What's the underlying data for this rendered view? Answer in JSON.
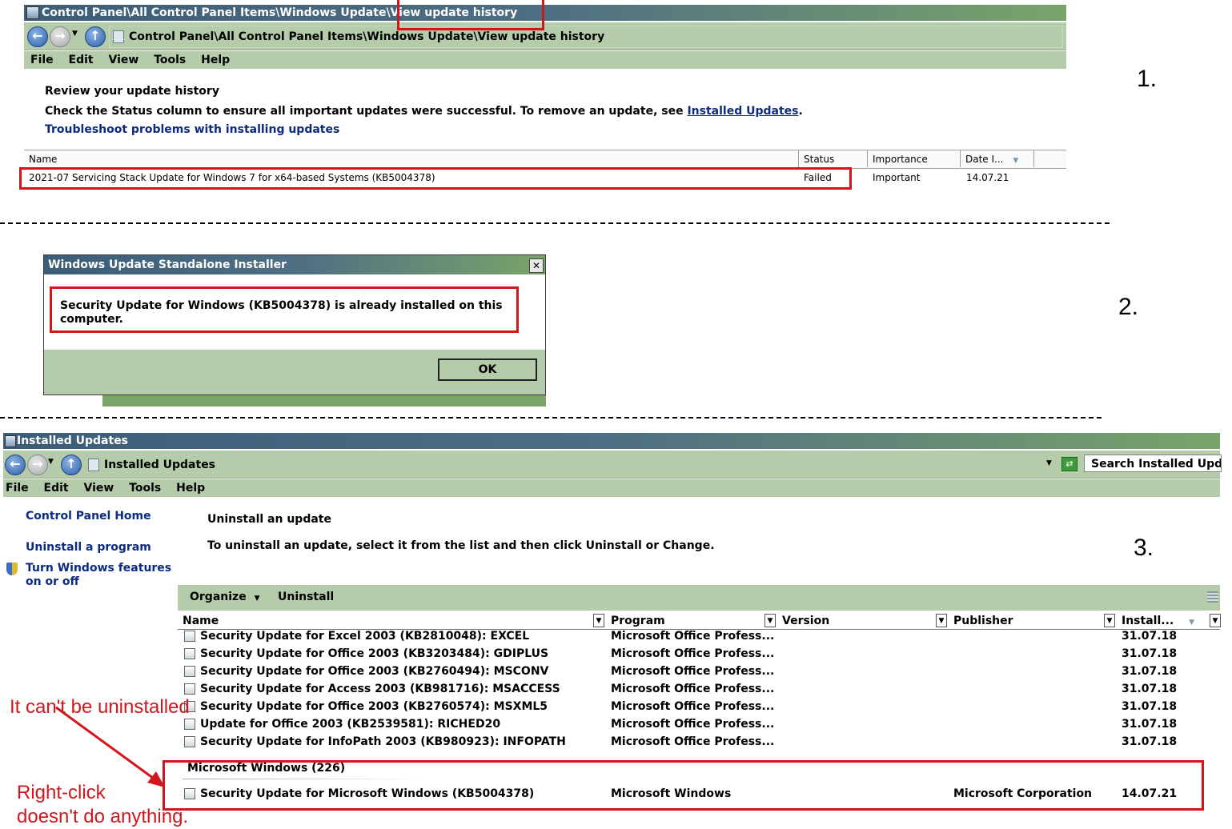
{
  "section1": {
    "title": "Control Panel\\All Control Panel Items\\Windows Update\\View update history",
    "address": "Control Panel\\All Control Panel Items\\Windows Update\\View update history",
    "menu": [
      "File",
      "Edit",
      "View",
      "Tools",
      "Help"
    ],
    "heading": "Review your update history",
    "description_prefix": "Check the Status column to ensure all important updates were successful. To remove an update, see ",
    "installed_updates_link": "Installed Updates",
    "description_suffix": ".",
    "troubleshoot_link": "Troubleshoot problems with installing updates",
    "columns": [
      "Name",
      "Status",
      "Importance",
      "Date I..."
    ],
    "row": {
      "name": "2021-07 Servicing Stack Update for Windows 7 for x64-based Systems (KB5004378)",
      "status": "Failed",
      "importance": "Important",
      "date": "14.07.21"
    },
    "number": "1."
  },
  "section2": {
    "title": "Windows Update Standalone Installer",
    "close_glyph": "✕",
    "message_line1": "Security Update for Windows (KB5004378) is already installed on this",
    "message_line2": "computer.",
    "ok_label": "OK",
    "number": "2."
  },
  "section3": {
    "title": "Installed Updates",
    "address": "Installed Updates",
    "search_placeholder": "Search Installed Upd",
    "menu": [
      "File",
      "Edit",
      "View",
      "Tools",
      "Help"
    ],
    "sidebar": {
      "home": "Control Panel Home",
      "uninstall_program": "Uninstall a program",
      "features_line1": "Turn Windows features",
      "features_line2": "on or off"
    },
    "heading": "Uninstall an update",
    "description": "To uninstall an update, select it from the list and then click Uninstall or Change.",
    "toolbar": {
      "organize": "Organize",
      "uninstall": "Uninstall"
    },
    "columns": [
      "Name",
      "Program",
      "Version",
      "Publisher",
      "Install..."
    ],
    "office_rows": [
      {
        "name": "Security Update for Excel 2003 (KB2810048): EXCEL",
        "program": "Microsoft Office Profess...",
        "date": "31.07.18"
      },
      {
        "name": "Security Update for Office 2003 (KB3203484): GDIPLUS",
        "program": "Microsoft Office Profess...",
        "date": "31.07.18"
      },
      {
        "name": "Security Update for Office 2003 (KB2760494): MSCONV",
        "program": "Microsoft Office Profess...",
        "date": "31.07.18"
      },
      {
        "name": "Security Update for Access 2003 (KB981716): MSACCESS",
        "program": "Microsoft Office Profess...",
        "date": "31.07.18"
      },
      {
        "name": "Security Update for Office 2003 (KB2760574): MSXML5",
        "program": "Microsoft Office Profess...",
        "date": "31.07.18"
      },
      {
        "name": "Update for Office 2003 (KB2539581): RICHED20",
        "program": "Microsoft Office Profess...",
        "date": "31.07.18"
      },
      {
        "name": "Security Update for InfoPath 2003 (KB980923): INFOPATH",
        "program": "Microsoft Office Profess...",
        "date": "31.07.18"
      }
    ],
    "group_label": "Microsoft Windows (226)",
    "windows_row": {
      "name": "Security Update for Microsoft Windows (KB5004378)",
      "program": "Microsoft Windows",
      "publisher": "Microsoft Corporation",
      "date": "14.07.21"
    },
    "number": "3."
  },
  "annotations": {
    "cant_uninstall": "It can't be uninstalled",
    "right_click_line1": "Right-click",
    "right_click_line2": "doesn't do anything."
  },
  "colors": {
    "annotation_red": "#d2171c",
    "chrome_green": "#b5ccaa",
    "link_blue": "#0b2a80"
  }
}
